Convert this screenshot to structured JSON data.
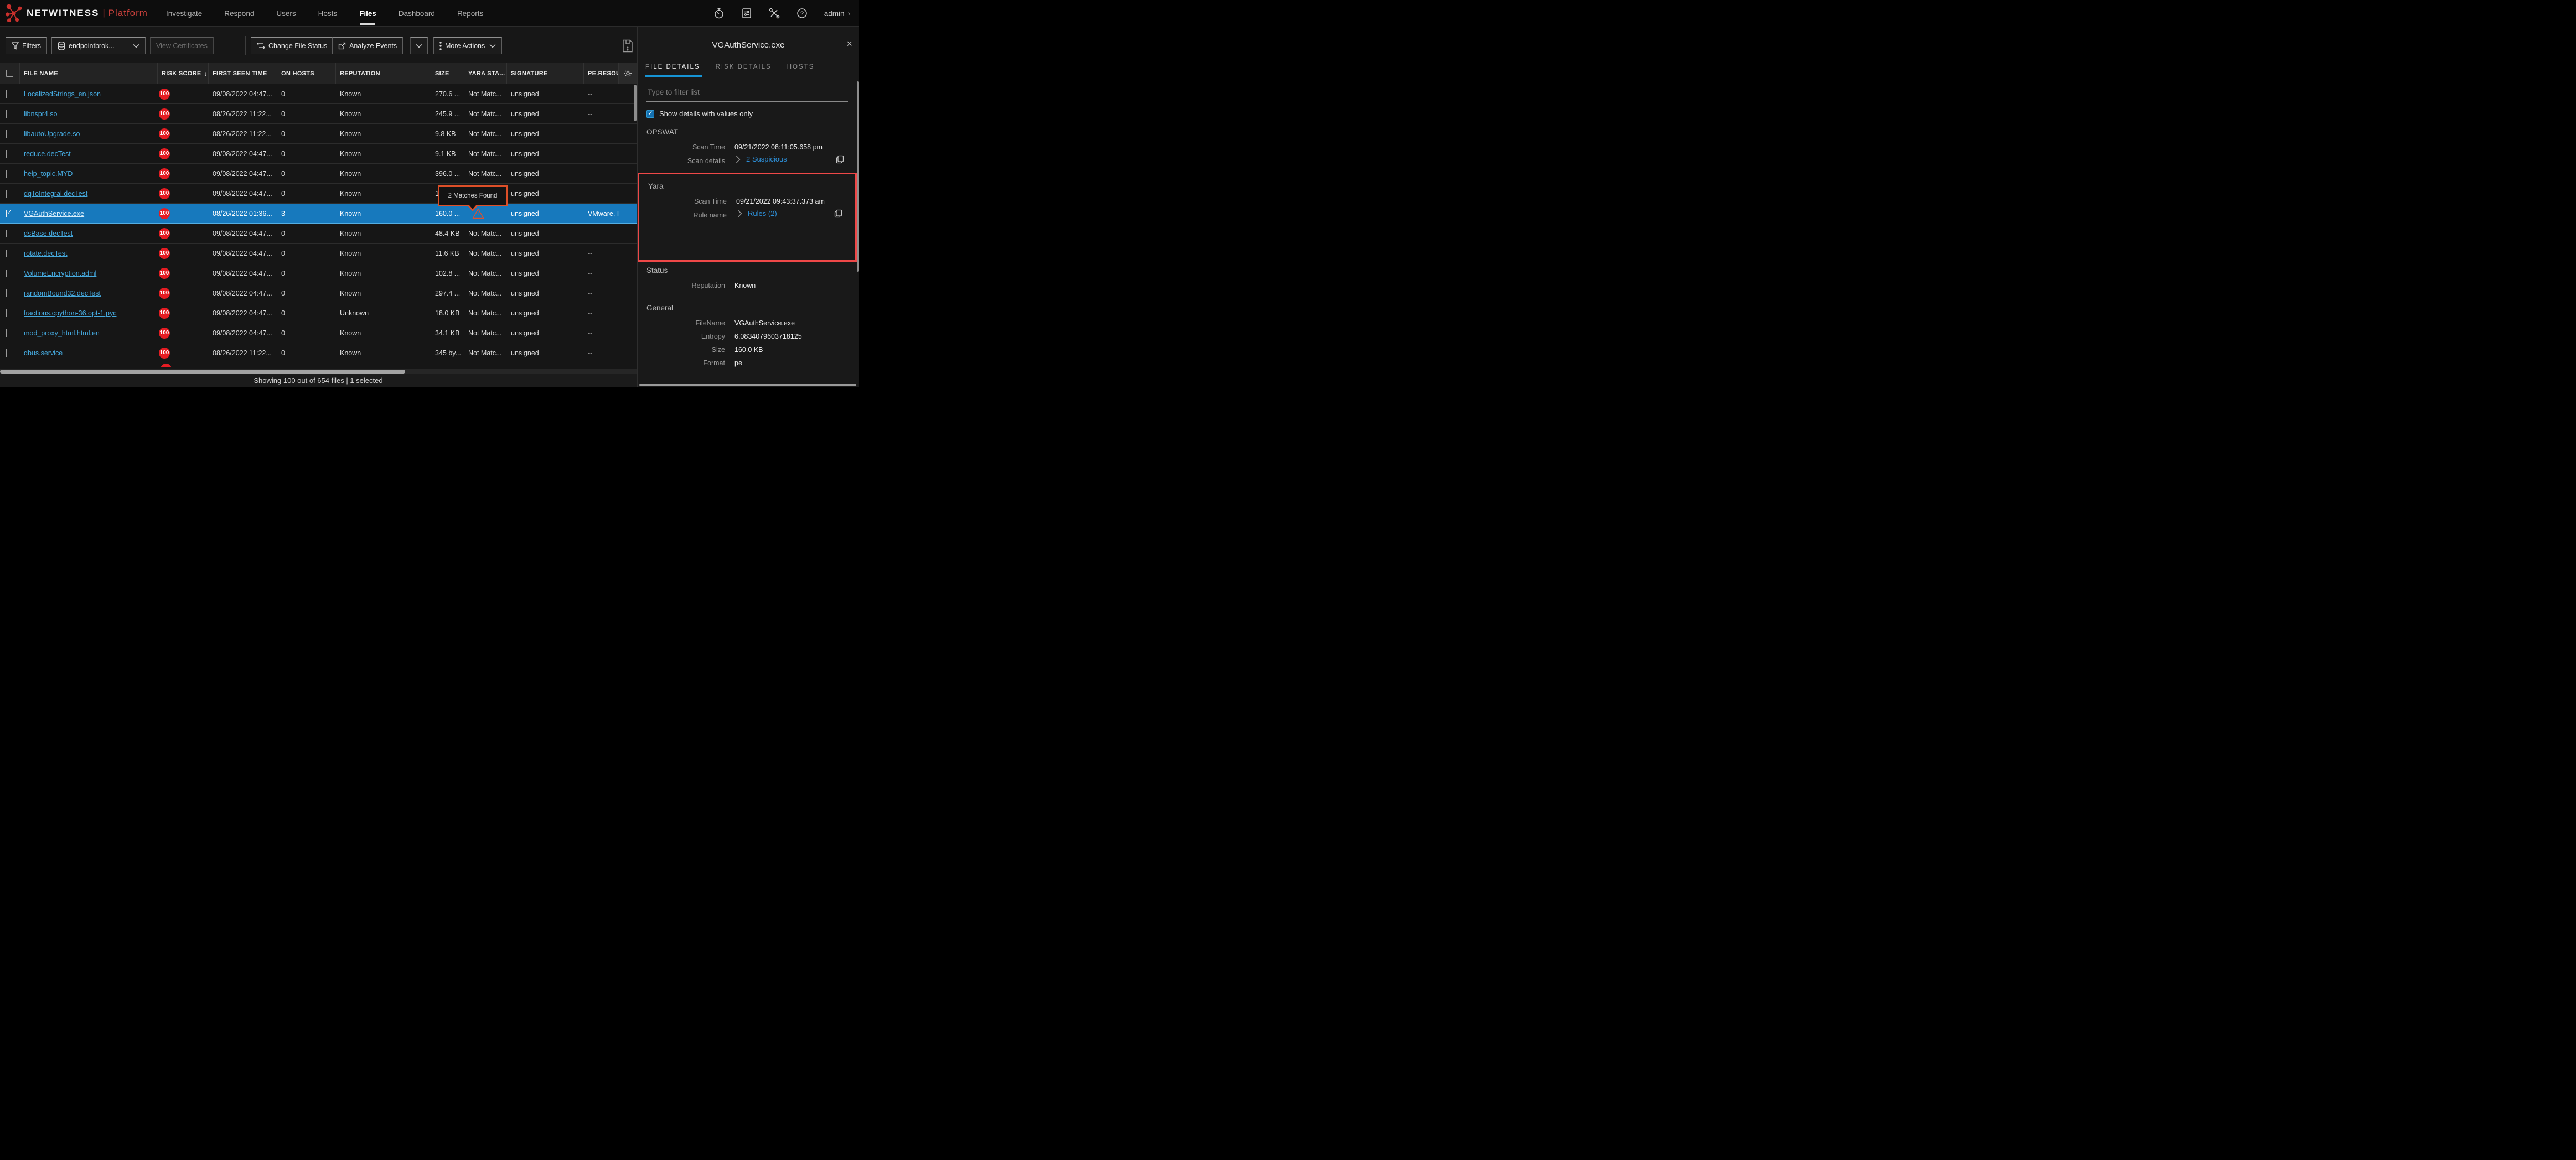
{
  "app": {
    "brand": "NETWITNESS",
    "brand_separator": "|",
    "brand_sub": "Platform",
    "user": "admin",
    "user_chevron": "›"
  },
  "nav": {
    "items": [
      {
        "label": "Investigate",
        "active": false
      },
      {
        "label": "Respond",
        "active": false
      },
      {
        "label": "Users",
        "active": false
      },
      {
        "label": "Hosts",
        "active": false
      },
      {
        "label": "Files",
        "active": true
      },
      {
        "label": "Dashboard",
        "active": false
      },
      {
        "label": "Reports",
        "active": false
      }
    ],
    "right_icons": [
      "timer-icon",
      "jobs-icon",
      "tools-icon",
      "help-icon"
    ]
  },
  "toolbar": {
    "filters_label": "Filters",
    "service_selector": "endpointbrok...",
    "view_certificates_label": "View Certificates",
    "change_file_status_label": "Change File Status",
    "analyze_events_label": "Analyze Events",
    "more_actions_label": "More Actions"
  },
  "table": {
    "columns": [
      "FILE NAME",
      "RISK SCORE",
      "FIRST SEEN TIME",
      "ON HOSTS",
      "REPUTATION",
      "SIZE",
      "YARA STA...",
      "SIGNATURE",
      "PE.RESOUI"
    ],
    "sort_arrow": "↓",
    "rows": [
      {
        "file": "LocalizedStrings_en.json",
        "score": "100",
        "seen": "09/08/2022 04:47...",
        "hosts": "0",
        "reputation": "Known",
        "size": "270.6 ...",
        "yara": "Not Matc...",
        "signature": "unsigned",
        "pe": "--",
        "selected": false,
        "checked": false
      },
      {
        "file": "libnspr4.so",
        "score": "100",
        "seen": "08/26/2022 11:22...",
        "hosts": "0",
        "reputation": "Known",
        "size": "245.9 ...",
        "yara": "Not Matc...",
        "signature": "unsigned",
        "pe": "--",
        "selected": false,
        "checked": false
      },
      {
        "file": "libautoUpgrade.so",
        "score": "100",
        "seen": "08/26/2022 11:22...",
        "hosts": "0",
        "reputation": "Known",
        "size": "9.8 KB",
        "yara": "Not Matc...",
        "signature": "unsigned",
        "pe": "--",
        "selected": false,
        "checked": false
      },
      {
        "file": "reduce.decTest",
        "score": "100",
        "seen": "09/08/2022 04:47...",
        "hosts": "0",
        "reputation": "Known",
        "size": "9.1 KB",
        "yara": "Not Matc...",
        "signature": "unsigned",
        "pe": "--",
        "selected": false,
        "checked": false
      },
      {
        "file": "help_topic.MYD",
        "score": "100",
        "seen": "09/08/2022 04:47...",
        "hosts": "0",
        "reputation": "Known",
        "size": "396.0 ...",
        "yara": "Not Matc...",
        "signature": "unsigned",
        "pe": "--",
        "selected": false,
        "checked": false
      },
      {
        "file": "dqToIntegral.decTest",
        "score": "100",
        "seen": "09/08/2022 04:47...",
        "hosts": "0",
        "reputation": "Known",
        "size": "1",
        "yara": "",
        "signature": "unsigned",
        "pe": "--",
        "selected": false,
        "checked": false
      },
      {
        "file": "VGAuthService.exe",
        "score": "100",
        "seen": "08/26/2022 01:36...",
        "hosts": "3",
        "reputation": "Known",
        "size": "160.0 ...",
        "yara": "",
        "warning": true,
        "signature": "unsigned",
        "pe": "VMware, Inc.",
        "selected": true,
        "checked": true
      },
      {
        "file": "dsBase.decTest",
        "score": "100",
        "seen": "09/08/2022 04:47...",
        "hosts": "0",
        "reputation": "Known",
        "size": "48.4 KB",
        "yara": "Not Matc...",
        "signature": "unsigned",
        "pe": "--",
        "selected": false,
        "checked": false
      },
      {
        "file": "rotate.decTest",
        "score": "100",
        "seen": "09/08/2022 04:47...",
        "hosts": "0",
        "reputation": "Known",
        "size": "11.6 KB",
        "yara": "Not Matc...",
        "signature": "unsigned",
        "pe": "--",
        "selected": false,
        "checked": false
      },
      {
        "file": "VolumeEncryption.adml",
        "score": "100",
        "seen": "09/08/2022 04:47...",
        "hosts": "0",
        "reputation": "Known",
        "size": "102.8 ...",
        "yara": "Not Matc...",
        "signature": "unsigned",
        "pe": "--",
        "selected": false,
        "checked": false
      },
      {
        "file": "randomBound32.decTest",
        "score": "100",
        "seen": "09/08/2022 04:47...",
        "hosts": "0",
        "reputation": "Known",
        "size": "297.4 ...",
        "yara": "Not Matc...",
        "signature": "unsigned",
        "pe": "--",
        "selected": false,
        "checked": false
      },
      {
        "file": "fractions.cpython-36.opt-1.pyc",
        "score": "100",
        "seen": "09/08/2022 04:47...",
        "hosts": "0",
        "reputation": "Unknown",
        "size": "18.0 KB",
        "yara": "Not Matc...",
        "signature": "unsigned",
        "pe": "--",
        "selected": false,
        "checked": false
      },
      {
        "file": "mod_proxy_html.html.en",
        "score": "100",
        "seen": "09/08/2022 04:47...",
        "hosts": "0",
        "reputation": "Known",
        "size": "34.1 KB",
        "yara": "Not Matc...",
        "signature": "unsigned",
        "pe": "--",
        "selected": false,
        "checked": false
      },
      {
        "file": "dbus.service",
        "score": "100",
        "seen": "08/26/2022 11:22...",
        "hosts": "0",
        "reputation": "Known",
        "size": "345 by...",
        "yara": "Not Matc...",
        "signature": "unsigned",
        "pe": "--",
        "selected": false,
        "checked": false
      }
    ],
    "partial_row_score": "100",
    "tooltip_text": "2 Matches Found",
    "footer": "Showing 100 out of 654 files | 1 selected"
  },
  "panel": {
    "title": "VGAuthService.exe",
    "close_glyph": "×",
    "tabs": [
      {
        "label": "FILE DETAILS",
        "active": true
      },
      {
        "label": "RISK DETAILS",
        "active": false
      },
      {
        "label": "HOSTS",
        "active": false
      }
    ],
    "filter_placeholder": "Type to filter list",
    "values_only_label": "Show details with values only",
    "values_only_checked": true,
    "sections": [
      {
        "title": "OPSWAT",
        "highlighted": false,
        "divider_after": false,
        "rows": [
          {
            "label": "Scan Time",
            "value": "09/21/2022 08:11:05.658 pm"
          },
          {
            "label": "Scan details",
            "link": "2 Suspicious",
            "copy": true
          }
        ]
      },
      {
        "title": "Yara",
        "highlighted": true,
        "divider_after": false,
        "rows": [
          {
            "label": "Scan Time",
            "value": "09/21/2022 09:43:37.373 am"
          },
          {
            "label": "Rule name",
            "link": "Rules (2)",
            "copy": true
          }
        ]
      },
      {
        "title": "Status",
        "highlighted": false,
        "divider_after": true,
        "rows": [
          {
            "label": "Reputation",
            "value": "Known"
          }
        ]
      },
      {
        "title": "General",
        "highlighted": false,
        "divider_after": false,
        "rows": [
          {
            "label": "FileName",
            "value": "VGAuthService.exe"
          },
          {
            "label": "Entropy",
            "value": "6.0834079603718125"
          },
          {
            "label": "Size",
            "value": "160.0 KB"
          },
          {
            "label": "Format",
            "value": "pe"
          }
        ]
      }
    ]
  },
  "colors": {
    "selected_row": "#1779bd",
    "risk_badge": "#e51c23",
    "link_blue": "#45a9de",
    "panel_link_blue": "#2d8fd8",
    "highlight_red": "#ef4848",
    "tooltip_border": "#dd4f28",
    "brand_red": "#c9403b",
    "tab_underline": "#1694d4"
  }
}
